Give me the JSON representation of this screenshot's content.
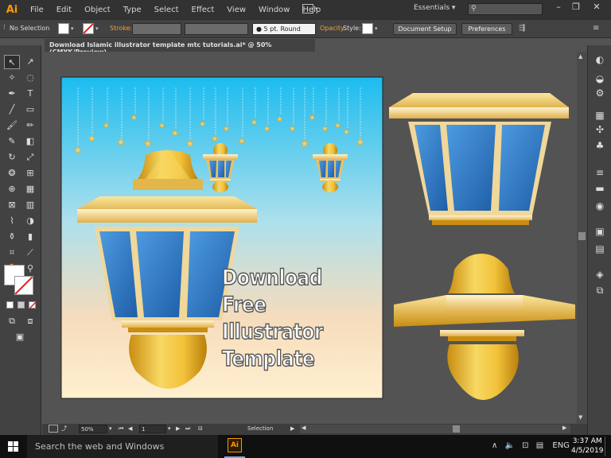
{
  "app": {
    "logo": "Ai"
  },
  "menu": [
    "File",
    "Edit",
    "Object",
    "Type",
    "Select",
    "Effect",
    "View",
    "Window",
    "Help"
  ],
  "workspace": "Essentials",
  "control_bar": {
    "selection": "No Selection",
    "stroke_label": "Stroke:",
    "brush": "5 pt. Round",
    "opacity_label": "Opacity",
    "style_label": "Style:",
    "document_setup": "Document Setup",
    "preferences": "Preferences"
  },
  "document_tab": "Download Islamic illustrator template mtc tutorials.ai* @ 50% (CMYK/Preview)",
  "artboard_text": [
    "Download",
    "Free",
    "Illustrator",
    "Template"
  ],
  "status": {
    "zoom": "50%",
    "page": "1",
    "tool": "Selection"
  },
  "taskbar": {
    "search_placeholder": "Search the web and Windows",
    "app_icon": "Ai",
    "lang": "ENG",
    "time": "3:37 AM",
    "date": "4/5/2019"
  },
  "colors": {
    "accent": "#ff9a00",
    "sky_top": "#1bbcef",
    "sky_bottom": "#fff0d0",
    "gold": "#f2c23a",
    "glass": "#2e79c4"
  }
}
